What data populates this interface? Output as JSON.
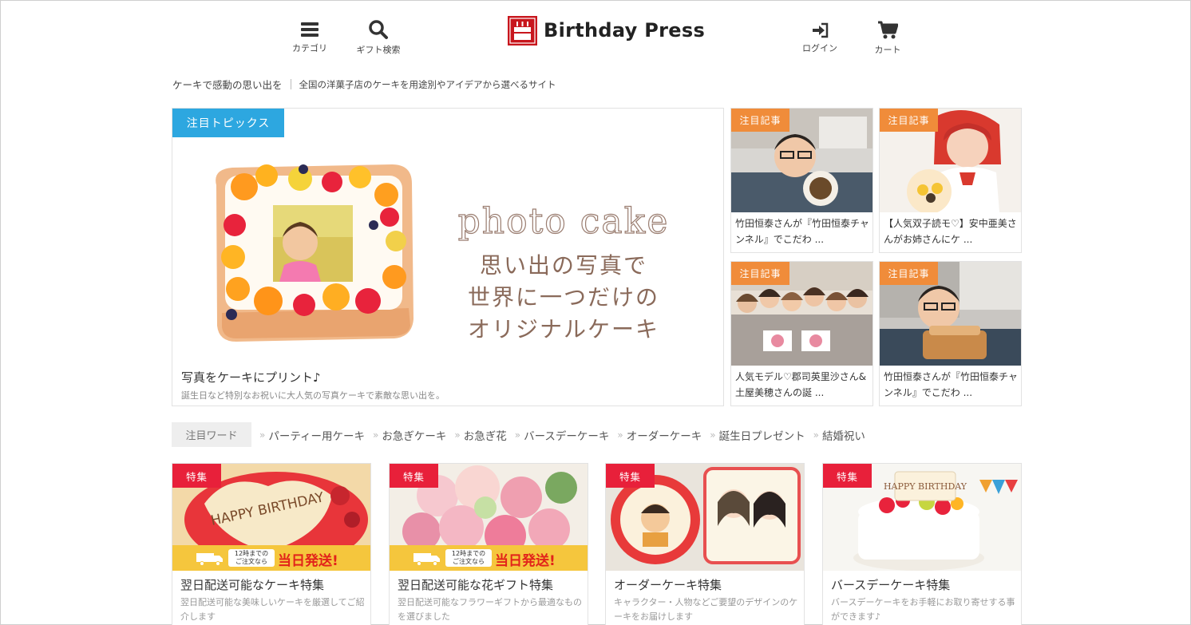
{
  "header": {
    "category_label": "カテゴリ",
    "gift_search_label": "ギフト検索",
    "logo_text": "Birthday Press",
    "login_label": "ログイン",
    "cart_label": "カート"
  },
  "tagline": {
    "primary": "ケーキで感動の思い出を",
    "secondary": "全国の洋菓子店のケーキを用途別やアイデアから選べるサイト"
  },
  "featured": {
    "badge": "注目トピックス",
    "hero_title": "photo cake",
    "hero_lines": [
      "思い出の写真で",
      "世界に一つだけの",
      "オリジナルケーキ"
    ],
    "title": "写真をケーキにプリント♪",
    "description": "誕生日など特別なお祝いに大人気の写真ケーキで素敵な思い出を。"
  },
  "articles": [
    {
      "badge": "注目記事",
      "title": "竹田恒泰さんが『竹田恒泰チャンネル』でこだわ ..."
    },
    {
      "badge": "注目記事",
      "title": "【人気双子読モ♡】安中亜美さんがお姉さんにケ ..."
    },
    {
      "badge": "注目記事",
      "title": "人気モデル♡郡司英里沙さん&土屋美穂さんの誕 ..."
    },
    {
      "badge": "注目記事",
      "title": "竹田恒泰さんが『竹田恒泰チャンネル』でこだわ ..."
    }
  ],
  "keywords": {
    "label": "注目ワード",
    "items": [
      "パーティー用ケーキ",
      "お急ぎケーキ",
      "お急ぎ花",
      "バースデーケーキ",
      "オーダーケーキ",
      "誕生日プレゼント",
      "結婚祝い"
    ]
  },
  "features": [
    {
      "badge": "特集",
      "title": "翌日配送可能なケーキ特集",
      "description": "翌日配送可能な美味しいケーキを厳選してご紹介します",
      "image_text": "HAPPY BIRTHDAY",
      "ship_until": "12時までの\nご注文なら",
      "ship_label": "当日発送!"
    },
    {
      "badge": "特集",
      "title": "翌日配送可能な花ギフト特集",
      "description": "翌日配送可能なフラワーギフトから最適なものを選びました",
      "ship_until": "12時までの\nご注文なら",
      "ship_label": "当日発送!"
    },
    {
      "badge": "特集",
      "title": "オーダーケーキ特集",
      "description": "キャラクター・人物などご要望のデザインのケーキをお届けします"
    },
    {
      "badge": "特集",
      "title": "バースデーケーキ特集",
      "description": "バースデーケーキをお手軽にお取り寄せする事ができます♪",
      "image_text": "HAPPY BIRTHDAY"
    }
  ],
  "colors": {
    "featured_badge": "#2da7e0",
    "article_badge": "#f08c3a",
    "feature_badge": "#e8203a",
    "logo": "#c8161d",
    "shipping_band": "#f5c63d"
  }
}
